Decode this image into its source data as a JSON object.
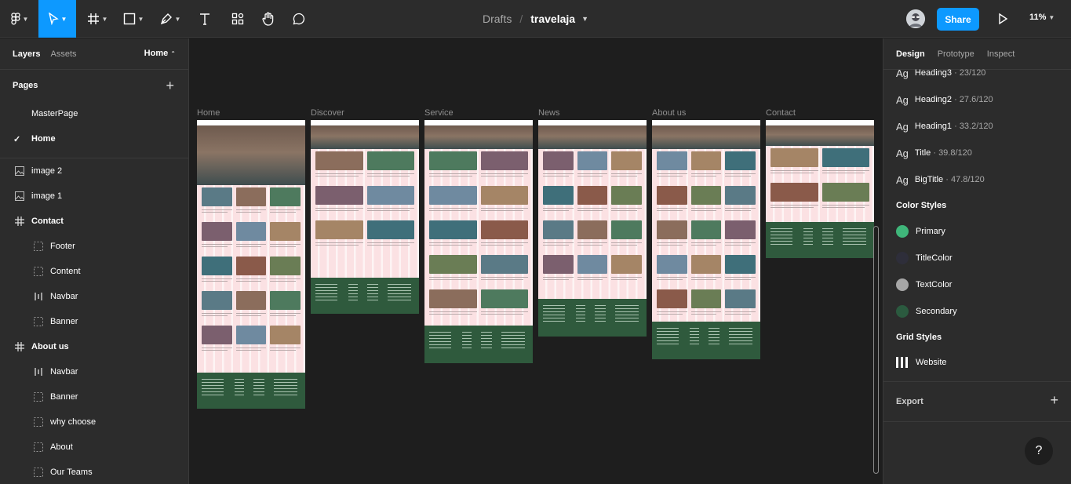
{
  "toolbar": {
    "breadcrumb_drafts": "Drafts",
    "breadcrumb_separator": "/",
    "file_name": "travelaja",
    "share_label": "Share",
    "zoom_level": "11%",
    "accent_color": "#0d99ff"
  },
  "left_panel": {
    "tab_layers": "Layers",
    "tab_assets": "Assets",
    "current_page": "Home",
    "pages_heading": "Pages",
    "pages": [
      {
        "label": "MasterPage",
        "selected": false
      },
      {
        "label": "Home",
        "selected": true
      }
    ],
    "layers": [
      {
        "label": "image 2",
        "icon": "image-icon",
        "indent": 0,
        "bold": false
      },
      {
        "label": "image 1",
        "icon": "image-icon",
        "indent": 0,
        "bold": false
      },
      {
        "label": "Contact",
        "icon": "frame-icon",
        "indent": 0,
        "bold": true
      },
      {
        "label": "Footer",
        "icon": "section-icon",
        "indent": 1,
        "bold": false
      },
      {
        "label": "Content",
        "icon": "section-icon",
        "indent": 1,
        "bold": false
      },
      {
        "label": "Navbar",
        "icon": "auto-layout-icon",
        "indent": 1,
        "bold": false
      },
      {
        "label": "Banner",
        "icon": "section-icon",
        "indent": 1,
        "bold": false
      },
      {
        "label": "About us",
        "icon": "frame-icon",
        "indent": 0,
        "bold": true
      },
      {
        "label": "Navbar",
        "icon": "auto-layout-icon",
        "indent": 1,
        "bold": false
      },
      {
        "label": "Banner",
        "icon": "section-icon",
        "indent": 1,
        "bold": false
      },
      {
        "label": "why choose",
        "icon": "section-icon",
        "indent": 1,
        "bold": false
      },
      {
        "label": "About",
        "icon": "section-icon",
        "indent": 1,
        "bold": false
      },
      {
        "label": "Our Teams",
        "icon": "section-icon",
        "indent": 1,
        "bold": false
      }
    ]
  },
  "canvas": {
    "frames": [
      "Home",
      "Discover",
      "Service",
      "News",
      "About us",
      "Contact"
    ]
  },
  "right_panel": {
    "tabs": [
      "Design",
      "Prototype",
      "Inspect"
    ],
    "text_styles": [
      {
        "name": "Heading3",
        "size": "· 23/120"
      },
      {
        "name": "Heading2",
        "size": "· 27.6/120"
      },
      {
        "name": "Heading1",
        "size": "· 33.2/120"
      },
      {
        "name": "Title",
        "size": "· 39.8/120"
      },
      {
        "name": "BigTitle",
        "size": "· 47.8/120"
      }
    ],
    "text_style_glyph": "Ag",
    "color_styles_heading": "Color Styles",
    "color_styles": [
      {
        "name": "Primary",
        "color": "#3fb67a"
      },
      {
        "name": "TitleColor",
        "color": "#2e2e3a"
      },
      {
        "name": "TextColor",
        "color": "#a6a6a6"
      },
      {
        "name": "Secondary",
        "color": "#2b5a3f"
      }
    ],
    "grid_styles_heading": "Grid Styles",
    "grid_styles": [
      {
        "name": "Website"
      }
    ],
    "export_label": "Export",
    "help_label": "?"
  }
}
